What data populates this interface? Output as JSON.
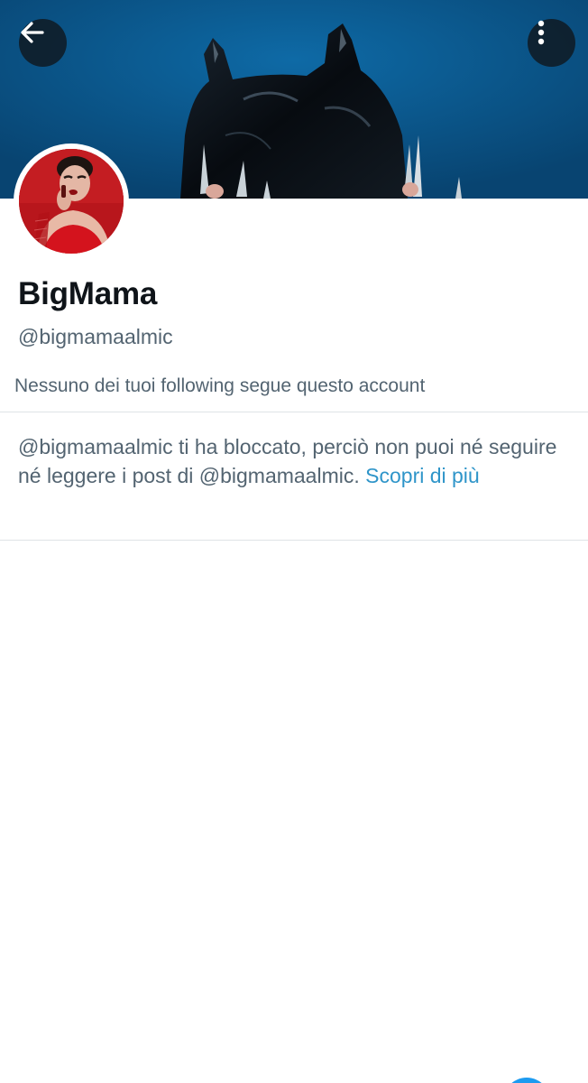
{
  "header": {
    "back_icon": "arrow-left-icon",
    "more_icon": "vertical-dots-icon"
  },
  "profile": {
    "display_name": "BigMama",
    "handle": "@bigmamaalmic",
    "followers_you_know": "Nessuno dei tuoi following segue questo account"
  },
  "blocked_notice": {
    "text": "@bigmamaalmic ti ha bloccato, perciò non puoi né seguire né leggere i post di @bigmamaalmic. ",
    "link_label": "Scopri di più"
  },
  "colors": {
    "primary_text": "#0f1419",
    "secondary_text": "#536471",
    "link": "#2f95c9",
    "banner_blue": "#0c5b92"
  }
}
